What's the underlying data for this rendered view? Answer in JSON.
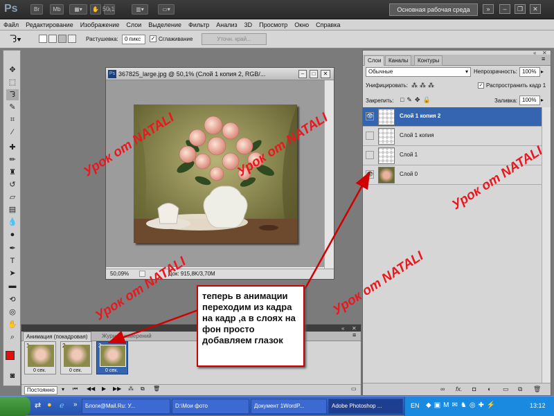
{
  "app": {
    "logo": "Ps",
    "bar_buttons": [
      "Br",
      "Mb"
    ],
    "zoom": "50,1",
    "workspace_label": "Основная рабочая среда"
  },
  "menu": [
    "Файл",
    "Редактирование",
    "Изображение",
    "Слои",
    "Выделение",
    "Фильтр",
    "Анализ",
    "3D",
    "Просмотр",
    "Окно",
    "Справка"
  ],
  "options": {
    "feather_label": "Растушевка:",
    "feather_value": "0 пикс",
    "antialias_label": "Сглаживание",
    "refine_button": "Уточн. край..."
  },
  "document": {
    "title": "367825_large.jpg @ 50,1% (Слой 1 копия 2, RGB/...",
    "zoom": "50,09%",
    "doc_info": "Док: 915,8K/3,70M"
  },
  "layers_panel": {
    "tabs": [
      "Слои",
      "Каналы",
      "Контуры"
    ],
    "blend_mode": "Обычные",
    "opacity_label": "Непрозрачность:",
    "opacity_value": "100%",
    "unify_label": "Унифицировать:",
    "propagate_label": "Распространить кадр 1",
    "lock_label": "Закрепить:",
    "fill_label": "Заливка:",
    "fill_value": "100%",
    "layers": [
      {
        "name": "Слой 1 копия 2",
        "visible": true,
        "selected": true
      },
      {
        "name": "Слой 1 копия",
        "visible": false,
        "selected": false
      },
      {
        "name": "Слой 1",
        "visible": false,
        "selected": false
      },
      {
        "name": "Слой 0",
        "visible": true,
        "selected": false
      }
    ],
    "footer_icons": [
      "link-icon",
      "fx-icon",
      "mask-icon",
      "adjustment-icon",
      "folder-icon",
      "new-layer-icon",
      "trash-icon"
    ]
  },
  "animation": {
    "tabs": [
      "Анимация (покадровая)",
      "Журнал измерений"
    ],
    "frames": [
      {
        "num": "1",
        "delay": "0 сек."
      },
      {
        "num": "2",
        "delay": "0 сек."
      },
      {
        "num": "3",
        "delay": "0 сек."
      }
    ],
    "loop": "Постоянно"
  },
  "watermark": "Урок от NATALI",
  "callout": "теперь в анимации переходим из кадра на кадр ,а в слоях на фон просто добавляем глазок",
  "taskbar": {
    "items": [
      "Блоги@Mail.Ru: У...",
      "D:\\Мои фото",
      "Документ 1WordP...",
      "Adobe Photoshop ..."
    ],
    "lang": "EN",
    "time": "13:12"
  },
  "colors": {
    "accent": "#3565b0",
    "watermark": "#e8181e",
    "arrow": "#d10000"
  }
}
